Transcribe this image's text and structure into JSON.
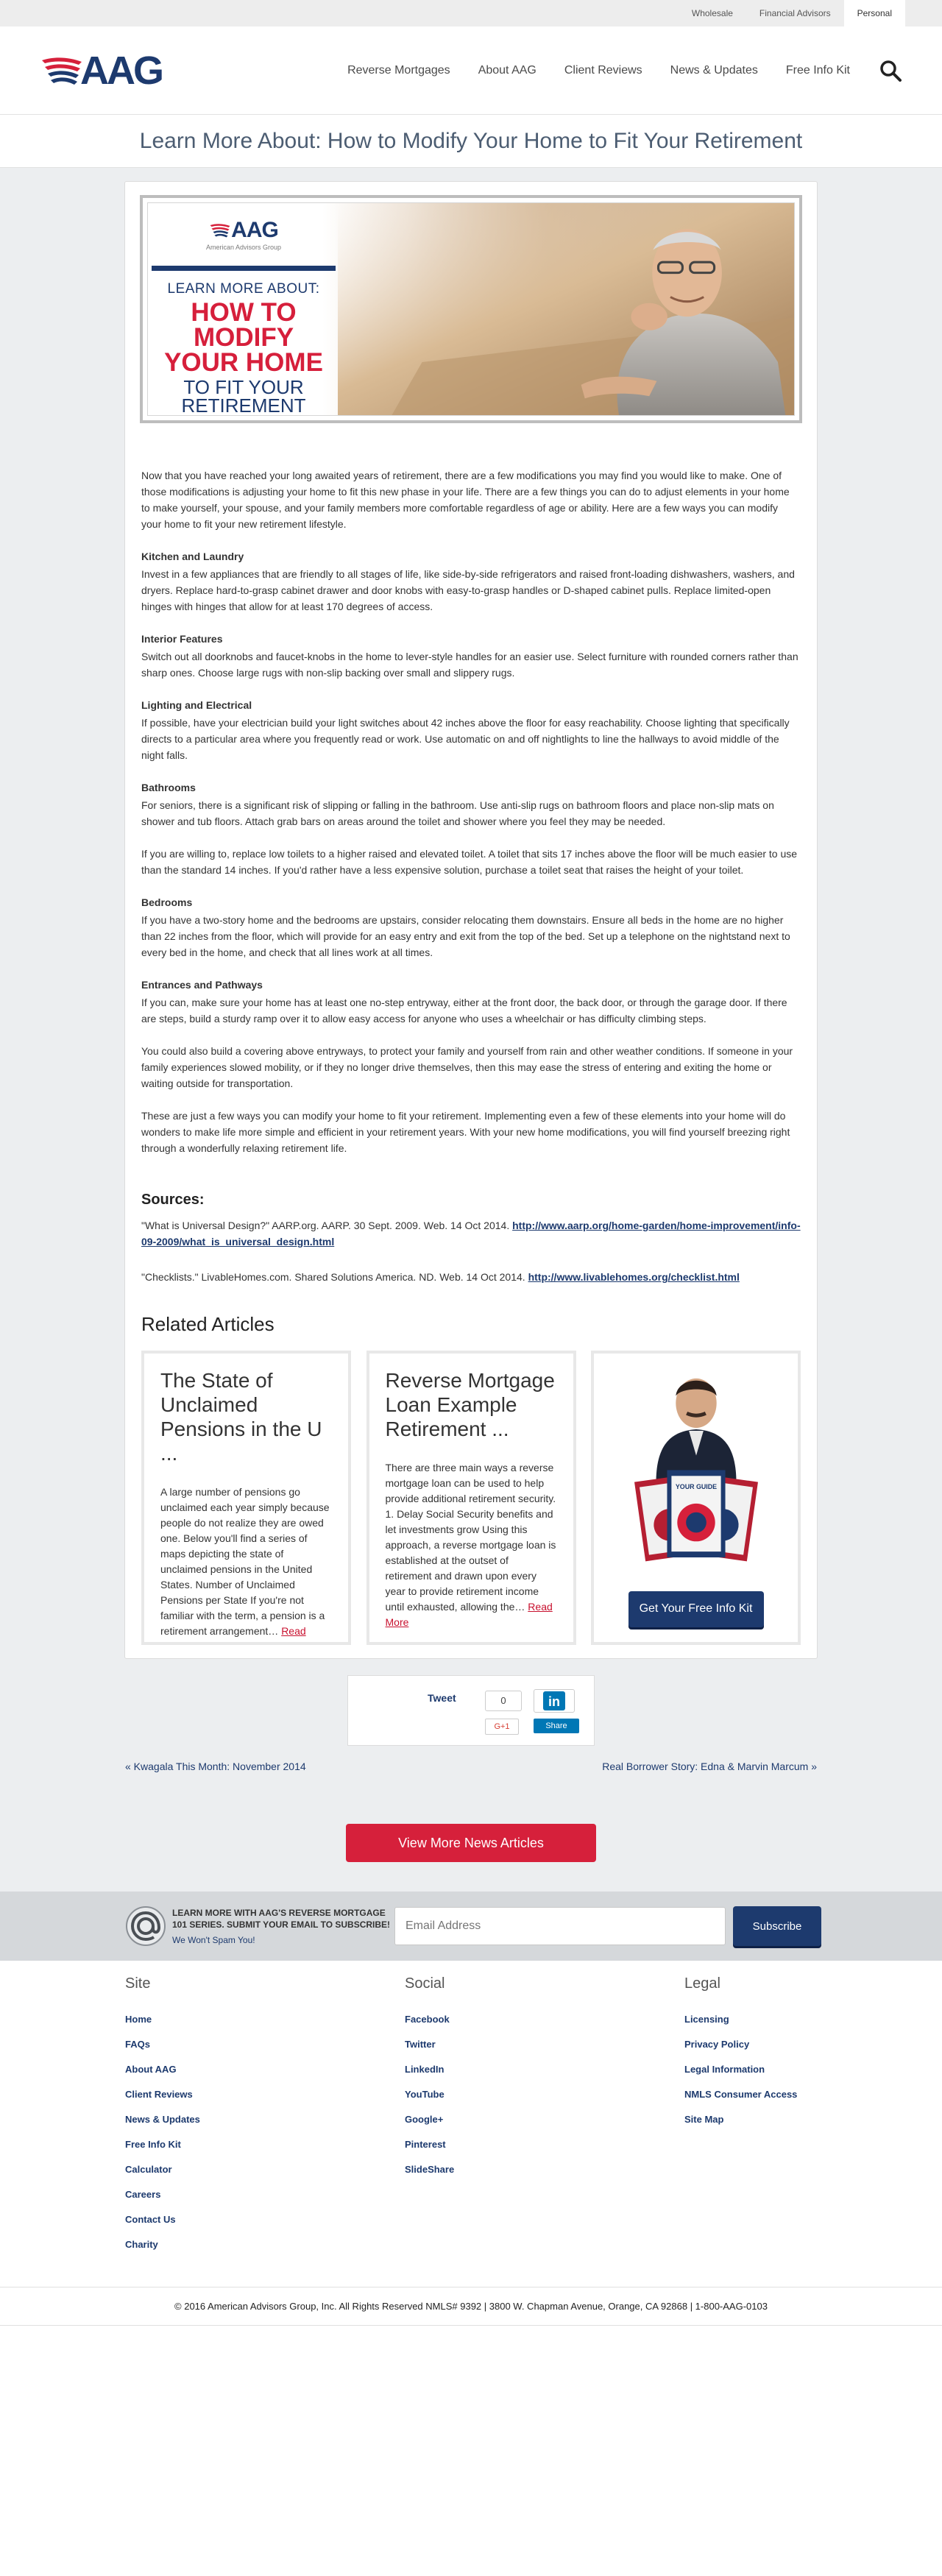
{
  "utility_nav": [
    "Wholesale",
    "Financial Advisors",
    "Personal"
  ],
  "brand": {
    "logo_text": "AAG"
  },
  "main_nav": [
    "Reverse Mortgages",
    "About AAG",
    "Client Reviews",
    "News & Updates",
    "Free Info Kit"
  ],
  "page_title": "Learn More About: How to Modify Your Home to Fit Your Retirement",
  "hero": {
    "logo_text": "AAG",
    "logo_sub": "American Advisors Group",
    "line1": "LEARN MORE ABOUT:",
    "big1": "HOW TO",
    "big2": "MODIFY",
    "big3": "YOUR HOME",
    "small1": "TO FIT YOUR",
    "small2": "RETIREMENT"
  },
  "article": {
    "intro": "Now that you have reached your long awaited years of retirement, there are a few modifications you may find you would like to make. One of those modifications is adjusting your home to fit this new phase in your life. There are a few things you can do to adjust elements in your home to make yourself, your spouse, and your family members more comfortable regardless of age or ability. Here are a few ways you can modify your home to fit your new retirement lifestyle.",
    "sections": [
      {
        "heading": "Kitchen and Laundry",
        "text": "Invest in a few appliances that are friendly to all stages of life, like side-by-side refrigerators and raised front-loading dishwashers, washers, and dryers. Replace hard-to-grasp cabinet drawer and door knobs with easy-to-grasp handles or D-shaped cabinet pulls. Replace limited-open hinges with hinges that allow for at least 170 degrees of access."
      },
      {
        "heading": "Interior Features",
        "text": "Switch out all doorknobs and faucet-knobs in the home to lever-style handles for an easier use. Select furniture with rounded corners rather than sharp ones. Choose large rugs with non-slip backing over small and slippery rugs."
      },
      {
        "heading": "Lighting and Electrical",
        "text": "If possible, have your electrician build your light switches about 42 inches above the floor for easy reachability. Choose lighting that specifically directs to a particular area where you frequently read or work. Use automatic on and off nightlights to line the hallways to avoid middle of the night falls."
      },
      {
        "heading": "Bathrooms",
        "text": "For seniors, there is a significant risk of slipping or falling in the bathroom. Use anti-slip rugs on bathroom floors and place non-slip mats on shower and tub floors. Attach grab bars on areas around the toilet and shower where you feel they may be needed."
      }
    ],
    "bath_extra": "If you are willing to, replace low toilets to a higher raised and elevated toilet. A toilet that sits 17 inches above the floor will be much easier to use than the standard 14 inches. If you'd rather have a less expensive solution, purchase a toilet seat that raises the height of your toilet.",
    "bedrooms_heading": "Bedrooms",
    "bedrooms_text": "If you have a two-story home and the bedrooms are upstairs, consider relocating them downstairs. Ensure all beds in the home are no higher than 22 inches from the floor, which will provide for an easy entry and exit from the top of the bed. Set up a telephone on the nightstand next to every bed in the home, and check that all lines work at all times.",
    "entrances_heading": "Entrances and Pathways",
    "entrances_text": "If you can, make sure your home has at least one no-step entryway, either at the front door, the back door, or through the garage door. If there are steps, build a sturdy ramp over it to allow easy access for anyone who uses a wheelchair or has difficulty climbing steps.",
    "covering_text": "You could also build a covering above entryways, to protect your family and yourself from rain and other weather conditions. If someone in your family experiences slowed mobility, or if they no longer drive themselves, then this may ease the stress of entering and exiting the home or waiting outside for transportation.",
    "closing_text": "These are just a few ways you can modify your home to fit your retirement. Implementing even a few of these elements into your home will do wonders to make life more simple and efficient in your retirement years. With your new home modifications, you will find yourself breezing right through a wonderfully relaxing retirement life."
  },
  "sources": {
    "title": "Sources:",
    "items": [
      {
        "text": "\"What is Universal Design?\" AARP.org. AARP. 30 Sept. 2009. Web. 14 Oct 2014. ",
        "link": "http://www.aarp.org/home-garden/home-improvement/info-09-2009/what_is_universal_design.html"
      },
      {
        "text": "\"Checklists.\" LivableHomes.com. Shared Solutions America. ND. Web. 14 Oct 2014. ",
        "link": "http://www.livablehomes.org/checklist.html"
      }
    ]
  },
  "related": {
    "title": "Related Articles",
    "cards": [
      {
        "title": "The State of Unclaimed Pensions in the U ...",
        "excerpt": "A large number of pensions go unclaimed each year simply because people do not realize they are owed one. Below you'll find a series of maps depicting the state of unclaimed pensions in the United States. Number of Unclaimed Pensions per State If you're not familiar with the term, a pension is a retirement arrangement…",
        "read_more": "Read More"
      },
      {
        "title": "Reverse Mortgage Loan Example Retirement ...",
        "excerpt": "There are three main ways a reverse mortgage loan can be used to help provide additional retirement security.   1. Delay Social Security benefits and let investments grow Using this approach, a reverse mortgage loan is established at the outset of retirement and drawn upon every year to provide retirement income until exhausted, allowing the…",
        "read_more": "Read More"
      }
    ],
    "kit_button": "Get Your Free Info Kit",
    "kit_book_title": "YOUR GUIDE"
  },
  "share": {
    "tweet": "Tweet",
    "tweet_count": "0",
    "gplus": "G+1",
    "linkedin_share": "Share",
    "linkedin_logo": "in"
  },
  "post_nav": {
    "prev": "« Kwagala This Month: November 2014",
    "next": "Real Borrower Story: Edna & Marvin Marcum »"
  },
  "more_news_button": "View More News Articles",
  "subscribe": {
    "text": "LEARN MORE WITH AAG'S REVERSE MORTGAGE 101 SERIES. SUBMIT YOUR EMAIL TO SUBSCRIBE!",
    "no_spam": "We Won't Spam You!",
    "placeholder": "Email Address",
    "button": "Subscribe"
  },
  "footer": {
    "site": {
      "title": "Site",
      "links": [
        "Home",
        "FAQs",
        "About AAG",
        "Client Reviews",
        "News & Updates",
        "Free Info Kit",
        "Calculator",
        "Careers",
        "Contact Us",
        "Charity"
      ]
    },
    "social": {
      "title": "Social",
      "links": [
        "Facebook",
        "Twitter",
        "LinkedIn",
        "YouTube",
        "Google+",
        "Pinterest",
        "SlideShare"
      ]
    },
    "legal": {
      "title": "Legal",
      "links": [
        "Licensing",
        "Privacy Policy",
        "Legal Information",
        "NMLS Consumer Access",
        "Site Map"
      ]
    }
  },
  "copyright": "© 2016 American Advisors Group, Inc. All Rights Reserved NMLS# 9392 | 3800 W. Chapman Avenue, Orange, CA 92868 | 1-800-AAG-0103",
  "colors": {
    "brand_navy": "#1d3a6e",
    "brand_red": "#d6203b",
    "page_bg": "#eceef0"
  }
}
